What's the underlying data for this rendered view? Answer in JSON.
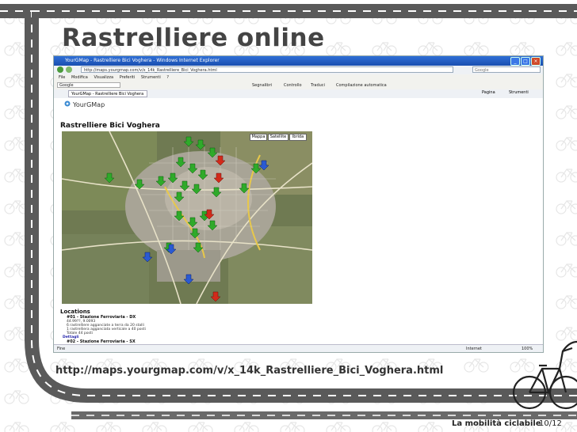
{
  "slide": {
    "title": "Rastrelliere online",
    "caption_url": "http://maps.yourgmap.com/v/x_14k_Rastrelliere_Bici_Voghera.html",
    "footer_label": "La mobilità ciclabile",
    "page_number": "10/12"
  },
  "browser": {
    "window_title": "YourGMap - Rastrelliere Bici Voghera - Windows Internet Explorer",
    "url": "http://maps.yourgmap.com/v/x_14k_Rastrelliere_Bici_Voghera.html",
    "search_engine": "Google",
    "menu_items": [
      "File",
      "Modifica",
      "Visualizza",
      "Preferiti",
      "Strumenti",
      "?"
    ],
    "toolbar_search_placeholder": "Google",
    "toolbar_items": [
      "Segnalibri",
      "Controllo",
      "Traduci",
      "Compilazione automatica"
    ],
    "tab_label": "YourGMap - Rastrelliere Bici Voghera",
    "tab_tools": [
      "Pagina",
      "Strumenti"
    ],
    "status_left": "Fine",
    "status_zone": "Internet",
    "zoom": "100%"
  },
  "page": {
    "logo_text": "YourGMap",
    "heading": "Rastrelliere Bici Voghera",
    "map_types": [
      "Mappa",
      "Satellite",
      "Ibrida"
    ],
    "locations_title": "Locations",
    "locations": [
      {
        "name": "#01 - Stazione Ferroviaria - DX",
        "details": [
          "44.99??, 9.0093",
          "6 rastrelliere agganciate a terra da 20 stalli",
          "1 rastrelliera agganciata verticale a 40 posti",
          "Totale 44 posti"
        ],
        "link": "Dettagli"
      },
      {
        "name": "#02 - Stazione Ferroviaria - SX",
        "details": [],
        "link": ""
      }
    ]
  },
  "colors": {
    "title_text": "#444444",
    "marker_green": "#2faa2a",
    "marker_red": "#d22a1a",
    "marker_blue": "#2a5ad2",
    "road_dark": "#555555"
  }
}
